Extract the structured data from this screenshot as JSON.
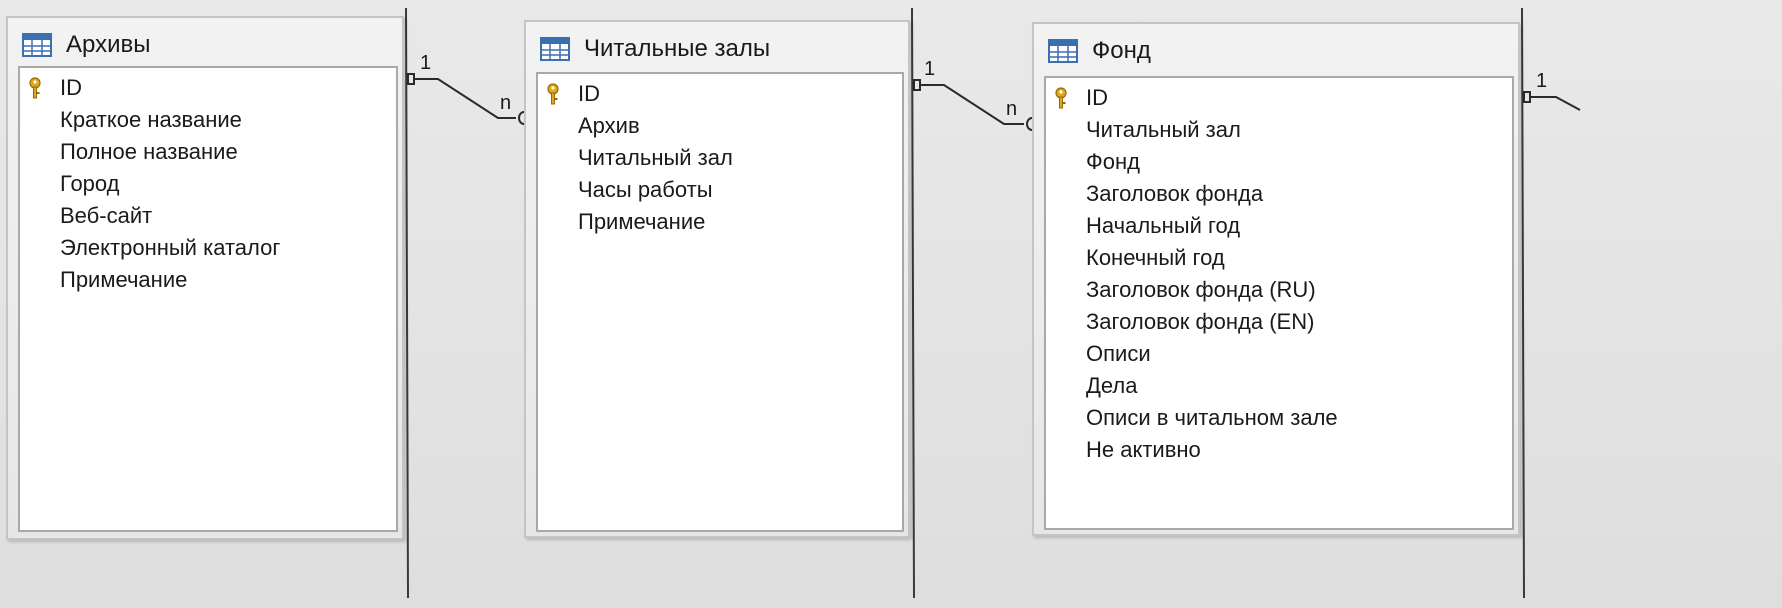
{
  "tables": [
    {
      "title": "Архивы",
      "fields": [
        {
          "label": "ID",
          "primary_key": true
        },
        {
          "label": "Краткое название",
          "primary_key": false
        },
        {
          "label": "Полное название",
          "primary_key": false
        },
        {
          "label": "Город",
          "primary_key": false
        },
        {
          "label": "Веб-сайт",
          "primary_key": false
        },
        {
          "label": "Электронный каталог",
          "primary_key": false
        },
        {
          "label": "Примечание",
          "primary_key": false
        }
      ]
    },
    {
      "title": "Читальные залы",
      "fields": [
        {
          "label": "ID",
          "primary_key": true
        },
        {
          "label": "Архив",
          "primary_key": false
        },
        {
          "label": "Читальный зал",
          "primary_key": false
        },
        {
          "label": "Часы работы",
          "primary_key": false
        },
        {
          "label": "Примечание",
          "primary_key": false
        }
      ]
    },
    {
      "title": "Фонд",
      "fields": [
        {
          "label": "ID",
          "primary_key": true
        },
        {
          "label": "Читальный зал",
          "primary_key": false
        },
        {
          "label": "Фонд",
          "primary_key": false
        },
        {
          "label": "Заголовок фонда",
          "primary_key": false
        },
        {
          "label": "Начальный год",
          "primary_key": false
        },
        {
          "label": "Конечный год",
          "primary_key": false
        },
        {
          "label": "Заголовок фонда (RU)",
          "primary_key": false
        },
        {
          "label": "Заголовок фонда (EN)",
          "primary_key": false
        },
        {
          "label": "Описи",
          "primary_key": false
        },
        {
          "label": "Дела",
          "primary_key": false
        },
        {
          "label": "Описи в читальном зале",
          "primary_key": false
        },
        {
          "label": "Не активно",
          "primary_key": false
        }
      ]
    }
  ],
  "relations": [
    {
      "from": "Архивы",
      "to": "Читальные залы",
      "from_cardinality": "1",
      "to_cardinality": "n"
    },
    {
      "from": "Читальные залы",
      "to": "Фонд",
      "from_cardinality": "1",
      "to_cardinality": "n"
    },
    {
      "from": "Фонд",
      "to": "",
      "from_cardinality": "1",
      "to_cardinality": ""
    }
  ],
  "colors": {
    "background": "#e4e4e4",
    "window_border": "#c4c4c4",
    "list_border": "#a9a9a9",
    "key_icon": "#e0a820",
    "table_icon": "#3a6fb0",
    "relation_line": "#2a2a2a"
  }
}
